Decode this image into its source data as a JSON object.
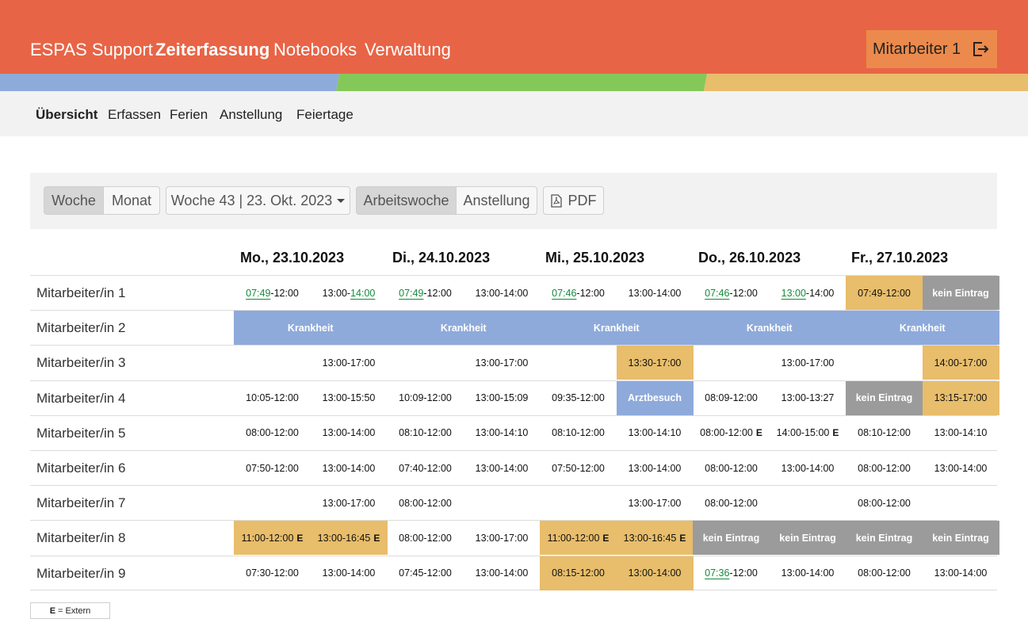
{
  "header": {
    "brand": "ESPAS Support",
    "nav": [
      "Zeiterfassung",
      "Notebooks",
      "Verwaltung"
    ],
    "user": "Mitarbeiter 1",
    "colors": {
      "bar": "#e86446",
      "user_button": "#eb8a4c",
      "strip": [
        "#8eaadb",
        "#85c85a",
        "#e8bd6b"
      ]
    }
  },
  "subnav": [
    "Übersicht",
    "Erfassen",
    "Ferien",
    "Anstellung",
    "Feiertage"
  ],
  "toolbar": {
    "period_woche": "Woche",
    "period_monat": "Monat",
    "week_select": "Woche 43 | 23. Okt. 2023",
    "view_arbeitswoche": "Arbeitswoche",
    "view_anstellung": "Anstellung",
    "pdf": "PDF"
  },
  "days": [
    "Mo., 23.10.2023",
    "Di., 24.10.2023",
    "Mi., 25.10.2023",
    "Do., 26.10.2023",
    "Fr., 27.10.2023"
  ],
  "rows": [
    {
      "name": "Mitarbeiter/in 1",
      "cells": [
        {
          "s": "07:49",
          "e": "-12:00",
          "hs": 1
        },
        {
          "s": "13:00-",
          "e": "14:00",
          "he": 1
        },
        {
          "s": "07:49",
          "e": "-12:00",
          "hs": 1
        },
        {
          "text": "13:00-14:00"
        },
        {
          "s": "07:46",
          "e": "-12:00",
          "hs": 1
        },
        {
          "text": "13:00-14:00"
        },
        {
          "s": "07:46",
          "e": "-12:00",
          "hs": 1
        },
        {
          "s": "13:00",
          "e": "-14:00",
          "hs": 1
        },
        {
          "text": "07:49-12:00",
          "c": "y"
        },
        {
          "text": "kein Eintrag",
          "c": "g"
        }
      ]
    },
    {
      "name": "Mitarbeiter/in 2",
      "cells": [
        {
          "text": "Krankheit",
          "c": "w",
          "span": 2
        },
        {
          "text": "Krankheit",
          "c": "w",
          "span": 2
        },
        {
          "text": "Krankheit",
          "c": "w",
          "span": 2
        },
        {
          "text": "Krankheit",
          "c": "w",
          "span": 2
        },
        {
          "text": "Krankheit",
          "c": "w",
          "span": 2
        }
      ]
    },
    {
      "name": "Mitarbeiter/in 3",
      "cells": [
        {
          "text": ""
        },
        {
          "text": "13:00-17:00"
        },
        {
          "text": ""
        },
        {
          "text": "13:00-17:00"
        },
        {
          "text": ""
        },
        {
          "text": "13:30-17:00",
          "c": "y"
        },
        {
          "text": ""
        },
        {
          "text": "13:00-17:00"
        },
        {
          "text": ""
        },
        {
          "text": "14:00-17:00",
          "c": "y"
        }
      ]
    },
    {
      "name": "Mitarbeiter/in 4",
      "cells": [
        {
          "text": "10:05-12:00"
        },
        {
          "text": "13:00-15:50"
        },
        {
          "text": "10:09-12:00"
        },
        {
          "text": "13:00-15:09"
        },
        {
          "text": "09:35-12:00"
        },
        {
          "text": "Arztbesuch",
          "c": "b"
        },
        {
          "text": "08:09-12:00"
        },
        {
          "text": "13:00-13:27"
        },
        {
          "text": "kein Eintrag",
          "c": "g"
        },
        {
          "text": "13:15-17:00",
          "c": "y"
        }
      ]
    },
    {
      "name": "Mitarbeiter/in 5",
      "cells": [
        {
          "text": "08:00-12:00"
        },
        {
          "text": "13:00-14:00"
        },
        {
          "text": "08:10-12:00"
        },
        {
          "text": "13:00-14:10"
        },
        {
          "text": "08:10-12:00"
        },
        {
          "text": "13:00-14:10"
        },
        {
          "text": "08:00-12:00",
          "ext": "E"
        },
        {
          "text": "14:00-15:00",
          "ext": "E"
        },
        {
          "text": "08:10-12:00"
        },
        {
          "text": "13:00-14:10"
        }
      ]
    },
    {
      "name": "Mitarbeiter/in 6",
      "cells": [
        {
          "text": "07:50-12:00"
        },
        {
          "text": "13:00-14:00"
        },
        {
          "text": "07:40-12:00"
        },
        {
          "text": "13:00-14:00"
        },
        {
          "text": "07:50-12:00"
        },
        {
          "text": "13:00-14:00"
        },
        {
          "text": "08:00-12:00"
        },
        {
          "text": "13:00-14:00"
        },
        {
          "text": "08:00-12:00"
        },
        {
          "text": "13:00-14:00"
        }
      ]
    },
    {
      "name": "Mitarbeiter/in 7",
      "cells": [
        {
          "text": ""
        },
        {
          "text": "13:00-17:00"
        },
        {
          "text": "08:00-12:00"
        },
        {
          "text": ""
        },
        {
          "text": ""
        },
        {
          "text": "13:00-17:00"
        },
        {
          "text": "08:00-12:00"
        },
        {
          "text": ""
        },
        {
          "text": "08:00-12:00"
        },
        {
          "text": ""
        }
      ]
    },
    {
      "name": "Mitarbeiter/in 8",
      "cells": [
        {
          "text": "11:00-12:00",
          "ext": "E",
          "c": "y"
        },
        {
          "text": "13:00-16:45",
          "ext": "E",
          "c": "y"
        },
        {
          "text": "08:00-12:00"
        },
        {
          "text": "13:00-17:00"
        },
        {
          "text": "11:00-12:00",
          "ext": "E",
          "c": "y"
        },
        {
          "text": "13:00-16:45",
          "ext": "E",
          "c": "y"
        },
        {
          "text": "kein Eintrag",
          "c": "g"
        },
        {
          "text": "kein Eintrag",
          "c": "g"
        },
        {
          "text": "kein Eintrag",
          "c": "g"
        },
        {
          "text": "kein Eintrag",
          "c": "g"
        }
      ]
    },
    {
      "name": "Mitarbeiter/in 9",
      "cells": [
        {
          "text": "07:30-12:00"
        },
        {
          "text": "13:00-14:00"
        },
        {
          "text": "07:45-12:00"
        },
        {
          "text": "13:00-14:00"
        },
        {
          "text": "08:15-12:00",
          "c": "y"
        },
        {
          "text": "13:00-14:00",
          "c": "y"
        },
        {
          "s": "07:36",
          "e": "-12:00",
          "hs": 1
        },
        {
          "text": "13:00-14:00"
        },
        {
          "text": "08:00-12:00"
        },
        {
          "text": "13:00-14:00"
        }
      ]
    }
  ],
  "legend": {
    "mark": "E",
    "text": "= Extern"
  }
}
